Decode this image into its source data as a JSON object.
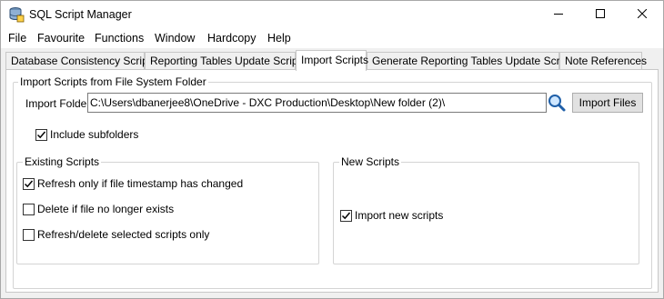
{
  "window": {
    "title": "SQL Script Manager",
    "icon": "database-icon",
    "controls": [
      "minimize-icon",
      "maximize-icon",
      "close-icon"
    ]
  },
  "menu": [
    "File",
    "Favourite",
    "Functions",
    "Window",
    "Hardcopy",
    "Help"
  ],
  "tabs": [
    {
      "label": "Database Consistency Scripts",
      "active": false
    },
    {
      "label": "Reporting Tables Update Scripts",
      "active": false
    },
    {
      "label": "Import Scripts",
      "active": true
    },
    {
      "label": "Generate Reporting Tables Update Scripts",
      "active": false
    },
    {
      "label": "Note References",
      "active": false
    }
  ],
  "import": {
    "group_title": "Import Scripts from File System Folder",
    "folder_label": "Import Folder",
    "folder_value": "C:\\Users\\dbanerjee8\\OneDrive - DXC Production\\Desktop\\New folder (2)\\",
    "browse_icon": "search-icon",
    "import_button": "Import Files",
    "include_subfolders_label": "Include subfolders",
    "include_subfolders_checked": true
  },
  "existing": {
    "title": "Existing Scripts",
    "options": [
      {
        "label": "Refresh only if file timestamp has changed",
        "checked": true
      },
      {
        "label": "Delete if file no longer exists",
        "checked": false
      },
      {
        "label": "Refresh/delete selected scripts only",
        "checked": false
      }
    ]
  },
  "new_scripts": {
    "title": "New Scripts",
    "option_label": "Import new scripts",
    "option_checked": true
  }
}
